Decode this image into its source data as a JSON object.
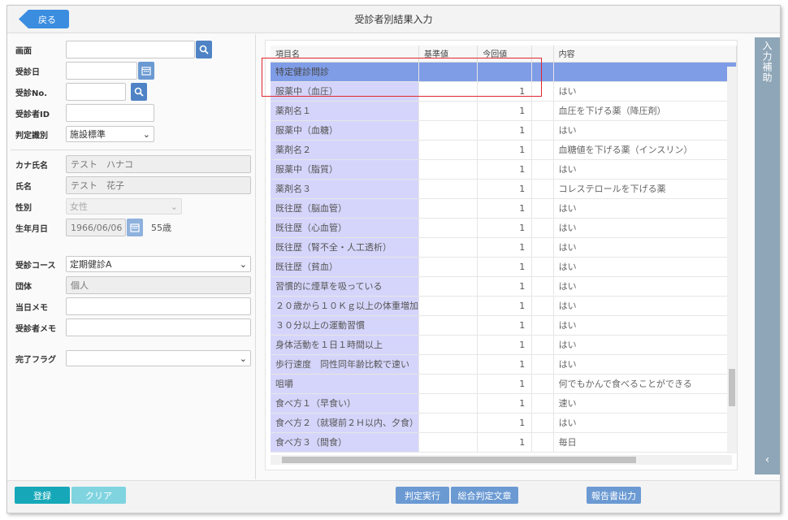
{
  "header": {
    "back_label": "戻る",
    "title": "受診者別結果入力"
  },
  "form": {
    "screen_label": "画面",
    "visit_date_label": "受診日",
    "visit_no_label": "受診No.",
    "patient_id_label": "受診者ID",
    "judgment_label": "判定識別",
    "judgment_value": "施設標準",
    "kana_label": "カナ氏名",
    "kana_value": "テスト　ハナコ",
    "name_label": "氏名",
    "name_value": "テスト　花子",
    "sex_label": "性別",
    "sex_value": "女性",
    "birth_label": "生年月日",
    "birth_value": "1966/06/06",
    "age_value": "55歳",
    "course_label": "受診コース",
    "course_value": "定期健診A",
    "group_label": "団体",
    "group_value": "個人",
    "day_memo_label": "当日メモ",
    "patient_memo_label": "受診者メモ",
    "complete_flag_label": "完了フラグ"
  },
  "grid": {
    "columns": [
      "項目名",
      "基準値",
      "今回値",
      "",
      "内容"
    ],
    "rows": [
      {
        "name": "特定健診問診",
        "value": "",
        "content": ""
      },
      {
        "name": "服薬中（血圧）",
        "value": "1",
        "content": "はい"
      },
      {
        "name": "薬剤名１",
        "value": "1",
        "content": "血圧を下げる薬（降圧剤）"
      },
      {
        "name": "服薬中（血糖）",
        "value": "1",
        "content": "はい"
      },
      {
        "name": "薬剤名２",
        "value": "1",
        "content": "血糖値を下げる薬（インスリン）"
      },
      {
        "name": "服薬中（脂質）",
        "value": "1",
        "content": "はい"
      },
      {
        "name": "薬剤名３",
        "value": "1",
        "content": "コレステロールを下げる薬"
      },
      {
        "name": "既往歴（脳血管）",
        "value": "1",
        "content": "はい"
      },
      {
        "name": "既往歴（心血管）",
        "value": "1",
        "content": "はい"
      },
      {
        "name": "既往歴（腎不全・人工透析）",
        "value": "1",
        "content": "はい"
      },
      {
        "name": "既往歴（貧血）",
        "value": "1",
        "content": "はい"
      },
      {
        "name": "習慣的に煙草を吸っている",
        "value": "1",
        "content": "はい"
      },
      {
        "name": "２０歳から１０Ｋｇ以上の体重増加",
        "value": "1",
        "content": "はい"
      },
      {
        "name": "３０分以上の運動習慣",
        "value": "1",
        "content": "はい"
      },
      {
        "name": "身体活動を１日１時間以上",
        "value": "1",
        "content": "はい"
      },
      {
        "name": "歩行速度　同性同年齢比較で速い",
        "value": "1",
        "content": "はい"
      },
      {
        "name": "咀嚼",
        "value": "1",
        "content": "何でもかんで食べることができる"
      },
      {
        "name": "食べ方１（早食い）",
        "value": "1",
        "content": "速い"
      },
      {
        "name": "食べ方２（就寝前２Ｈ以内、夕食）",
        "value": "1",
        "content": "はい"
      },
      {
        "name": "食べ方３（間食）",
        "value": "1",
        "content": "毎日"
      }
    ]
  },
  "side_tab": {
    "label": "入力補助"
  },
  "footer": {
    "register_label": "登録",
    "clear_label": "クリア",
    "judge_label": "判定実行",
    "summary_label": "総合判定文章",
    "report_label": "報告書出力"
  },
  "colors": {
    "accent": "#3b8de0",
    "highlight": "#7f9ce6",
    "name_col": "#d5d5fb",
    "register": "#16a8b8",
    "side_tab": "#8ea6b7"
  }
}
